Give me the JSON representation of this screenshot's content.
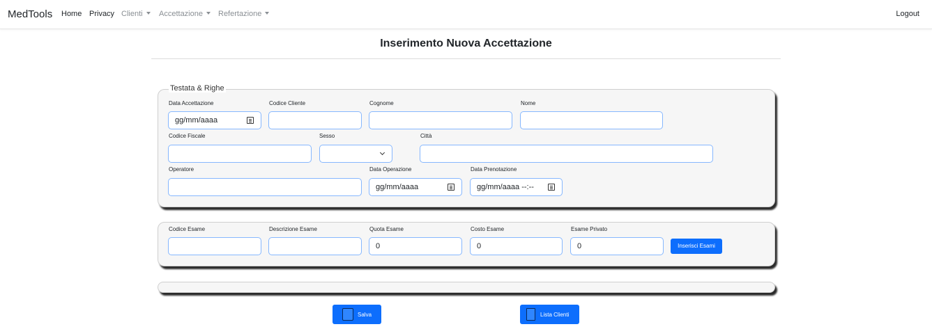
{
  "navbar": {
    "brand": "MedTools",
    "items": [
      {
        "label": "Home"
      },
      {
        "label": "Privacy"
      },
      {
        "label": "Clienti"
      },
      {
        "label": "Accettazione"
      },
      {
        "label": "Refertazione"
      }
    ],
    "logout": "Logout"
  },
  "page": {
    "title": "Inserimento Nuova Accettazione"
  },
  "testata": {
    "legend": "Testata & Righe",
    "data_accettazione": {
      "label": "Data Accettazione",
      "placeholder": "gg/mm/aaaa"
    },
    "codice_cliente": {
      "label": "Codice Cliente",
      "value": ""
    },
    "cognome": {
      "label": "Cognome",
      "value": ""
    },
    "nome": {
      "label": "Nome",
      "value": ""
    },
    "codice_fiscale": {
      "label": "Codice Fiscale",
      "value": ""
    },
    "sesso": {
      "label": "Sesso",
      "value": ""
    },
    "citta": {
      "label": "Città",
      "value": ""
    },
    "operatore": {
      "label": "Operatore",
      "value": ""
    },
    "data_operazione": {
      "label": "Data Operazione",
      "placeholder": "gg/mm/aaaa"
    },
    "data_prenotazione": {
      "label": "Data Prenotazione",
      "placeholder": "gg/mm/aaaa --:--"
    }
  },
  "esami": {
    "codice_esame": {
      "label": "Codice Esame",
      "value": ""
    },
    "descrizione_esame": {
      "label": "Descrizione Esame",
      "value": ""
    },
    "quota_esame": {
      "label": "Quota Esame",
      "value": "0"
    },
    "costo_esame": {
      "label": "Costo Esame",
      "value": "0"
    },
    "esame_privato": {
      "label": "Esame Privato",
      "value": "0"
    },
    "inserisci_label": "Inserisci Esami"
  },
  "actions": {
    "salva_label": "Salva",
    "lista_clienti_label": "Lista Clienti"
  },
  "colors": {
    "primary": "#0d6efd",
    "input_border": "#86b7fe",
    "panel_bg": "#f6f6f6"
  }
}
